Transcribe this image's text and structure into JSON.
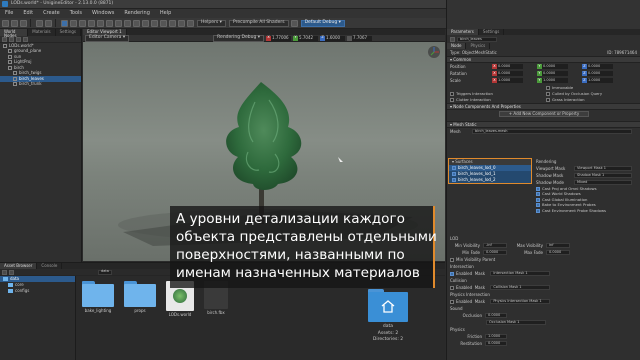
{
  "window": {
    "title": "LODs.world* - UnigineEditor - 2.13.0.0 (8871)",
    "controls": [
      "–",
      "□",
      "✕"
    ]
  },
  "menu": [
    "File",
    "Edit",
    "Create",
    "Tools",
    "Windows",
    "Rendering",
    "Help"
  ],
  "toolbar": {
    "helpers": "Helpers",
    "precompile": "Precompile All Shaders",
    "default_debug": "Default Debug"
  },
  "left_panel": {
    "tabs": [
      "World Nodes",
      "Materials",
      "Settings"
    ],
    "nodes": [
      {
        "label": "LODs.world*",
        "depth": 0,
        "selected": false
      },
      {
        "label": "ground_plane",
        "depth": 1,
        "selected": false
      },
      {
        "label": "sun",
        "depth": 1,
        "selected": false
      },
      {
        "label": "LightProj",
        "depth": 1,
        "selected": false
      },
      {
        "label": "birch",
        "depth": 1,
        "selected": false
      },
      {
        "label": "birch_twigs",
        "depth": 2,
        "selected": false
      },
      {
        "label": "birch_leaves",
        "depth": 2,
        "selected": true
      },
      {
        "label": "birch_trunk",
        "depth": 2,
        "selected": false
      }
    ]
  },
  "viewport": {
    "tab": "Editor Viewport 1",
    "camera": "Editor Camera",
    "rendering_debug": "Rendering Debug",
    "coords": [
      {
        "axis": "X",
        "value": "1.77006",
        "color": "#b33636"
      },
      {
        "axis": "Y",
        "value": "5.7042",
        "color": "#4a9a3a"
      },
      {
        "axis": "Z",
        "value": "1.6000",
        "color": "#3a6cc0"
      },
      {
        "axis": "",
        "value": "7.7067",
        "color": "#555555"
      }
    ]
  },
  "properties": {
    "tabs": [
      "Parameters",
      "Settings"
    ],
    "node_name": "birch_leaves",
    "sub_tabs": [
      "Node",
      "Physics"
    ],
    "type_label": "Type:",
    "type_value": "ObjectMeshStatic",
    "id_label": "ID:",
    "id_value": "789671464",
    "common_section": "Common",
    "transform": [
      {
        "label": "Position",
        "x": "0.0000",
        "y": "0.0000",
        "z": "0.0000"
      },
      {
        "label": "Rotation",
        "x": "0.0000",
        "y": "0.0000",
        "z": "0.0000"
      },
      {
        "label": "Scale",
        "x": "1.0000",
        "y": "1.0000",
        "z": "1.0000"
      }
    ],
    "flags": [
      {
        "label": "Immovable",
        "on": false
      },
      {
        "label": "Triggers Interaction",
        "on": false
      },
      {
        "label": "Culled by Occlusion Query",
        "on": false
      },
      {
        "label": "Clutter Interaction",
        "on": false
      },
      {
        "label": "Grass Interaction",
        "on": false
      }
    ],
    "components_section": "Node Components And Properties",
    "add_component": "Add New Component or Property",
    "mesh_section": "Mesh Static",
    "mesh_label": "Mesh",
    "mesh_value": "birch_leaves.mesh",
    "surfaces_section": "Surfaces",
    "surfaces": [
      "birch_leaves_lod_0",
      "birch_leaves_lod_1",
      "birch_leaves_lod_2"
    ],
    "rendering_section": "Rendering",
    "rendering_rows": [
      {
        "label": "Viewport Mask",
        "value": "Viewport Mask 1"
      },
      {
        "label": "Shadow Mask",
        "value": "Shadow Mask 1"
      },
      {
        "label": "Shadow Mode",
        "value": "Mixed"
      }
    ],
    "rendering_flags": [
      "Cast Proj and Omni Shadows",
      "Cast World Shadows",
      "Cast Global Illumination",
      "Bake to Environment Probes",
      "Cast Environment Probe Shadows"
    ],
    "lod_section": "LOD",
    "lod_rows": [
      {
        "label": "Min Visibility",
        "value": "-inf",
        "label2": "Max Visibility",
        "value2": "inf"
      },
      {
        "label": "Min Fade",
        "value": "0.0000",
        "label2": "Max Fade",
        "value2": "0.0000"
      }
    ],
    "lod_extra": "Min Visibility Parent",
    "intersection_section": "Intersection",
    "intersection_mask": "Intersection Mask 1",
    "collision_section": "Collision",
    "collision_mask": "Collision Mask 1",
    "physics_section": "Physics Intersection",
    "physics_mask": "Physics Intersection Mask 1",
    "sound_section": "Sound",
    "occlusion_label": "Occlusion",
    "occlusion_value": "0.0000",
    "occlusion_mask": "Occlusion Mask 1",
    "physics2_section": "Physics",
    "friction_label": "Friction",
    "friction_value": "1.0000",
    "restitution_label": "Restitution",
    "restitution_value": "0.0000",
    "enabled_label": "Enabled",
    "mask_label": "Mask"
  },
  "assets": {
    "tabs": [
      "Asset Browser",
      "Console"
    ],
    "tree": [
      "data",
      "core",
      "configs"
    ],
    "path": "data",
    "files": [
      "bake_lighting",
      "props",
      "LODs.world",
      "birch.fbx"
    ],
    "selected_name": "data",
    "selected_info_1": "Assets: 2",
    "selected_info_2": "Directories: 2"
  },
  "caption": {
    "lines": [
      "А уровни детализации каждого",
      "объекта представлены отдельными",
      "поверхностями, названными по",
      "именам назначенных материалов"
    ]
  },
  "colors": {
    "accent": "#3d6fa8",
    "highlight": "#e08a2c",
    "x_axis": "#b33636",
    "y_axis": "#4a9a3a",
    "z_axis": "#3a6cc0"
  }
}
